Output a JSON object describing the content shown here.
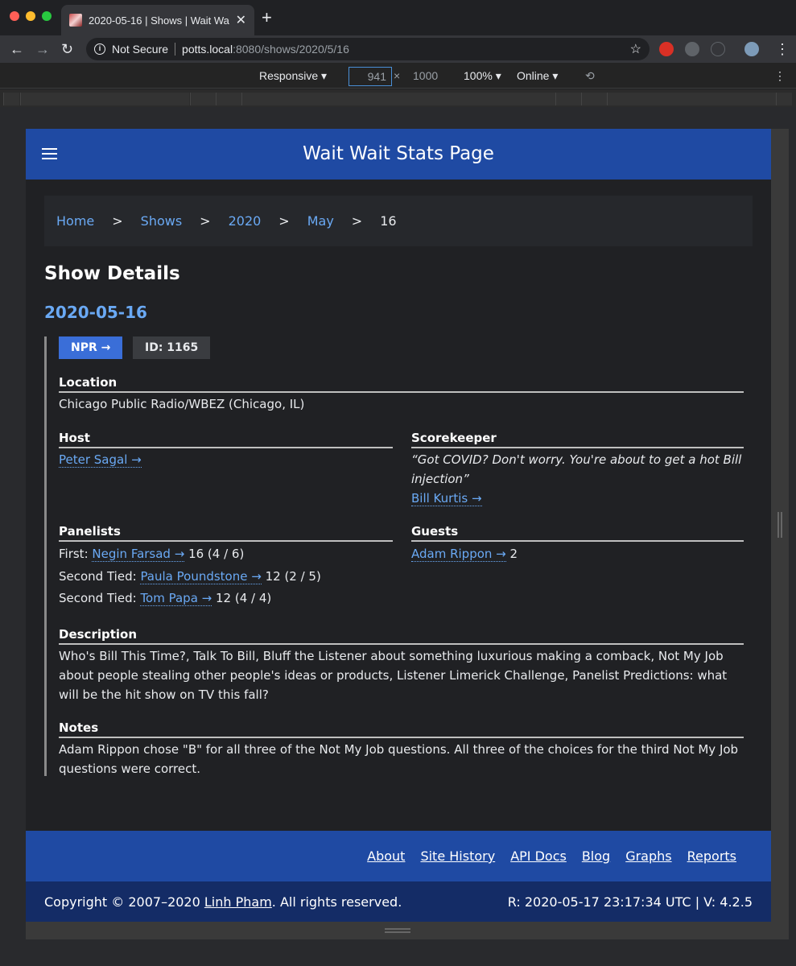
{
  "browser": {
    "tab_title": "2020-05-16 | Shows | Wait Wa",
    "url_security": "Not Secure",
    "url_host": "potts.local",
    "url_rest": ":8080/shows/2020/5/16"
  },
  "devtools": {
    "device": "Responsive",
    "width": "941",
    "times": "×",
    "height": "1000",
    "zoom": "100%",
    "network": "Online"
  },
  "site": {
    "title": "Wait Wait Stats Page"
  },
  "breadcrumb": {
    "home": "Home",
    "shows": "Shows",
    "year": "2020",
    "month": "May",
    "day": "16",
    "sep": ">"
  },
  "show": {
    "heading": "Show Details",
    "date": "2020-05-16",
    "npr_badge": "NPR →",
    "id_badge": "ID: 1165",
    "location_label": "Location",
    "location": "Chicago Public Radio/WBEZ (Chicago, IL)",
    "host_label": "Host",
    "host": "Peter Sagal →",
    "scorekeeper_label": "Scorekeeper",
    "scorekeeper_quote": "“Got COVID? Don't worry. You're about to get a hot Bill injection”",
    "scorekeeper": "Bill Kurtis →",
    "panelists_label": "Panelists",
    "panelists": [
      {
        "place": "First:",
        "name": "Negin Farsad →",
        "score": "16 (4 / 6)"
      },
      {
        "place": "Second Tied:",
        "name": "Paula Poundstone →",
        "score": "12 (2 / 5)"
      },
      {
        "place": "Second Tied:",
        "name": "Tom Papa →",
        "score": "12 (4 / 4)"
      }
    ],
    "guests_label": "Guests",
    "guest": "Adam Rippon →",
    "guest_score": "2",
    "description_label": "Description",
    "description": "Who's Bill This Time?, Talk To Bill, Bluff the Listener about something luxurious making a comback, Not My Job about people stealing other people's ideas or products, Listener Limerick Challenge, Panelist Predictions: what will be the hit show on TV this fall?",
    "notes_label": "Notes",
    "notes": "Adam Rippon chose \"B\" for all three of the Not My Job questions. All three of the choices for the third Not My Job questions were correct."
  },
  "footer": {
    "links": [
      "About",
      "Site History",
      "API Docs",
      "Blog",
      "Graphs",
      "Reports"
    ],
    "copyright_prefix": "Copyright © 2007–2020 ",
    "author": "Linh Pham",
    "copyright_suffix": ". All rights reserved.",
    "version": "R: 2020-05-17 23:17:34 UTC | V: 4.2.5"
  }
}
